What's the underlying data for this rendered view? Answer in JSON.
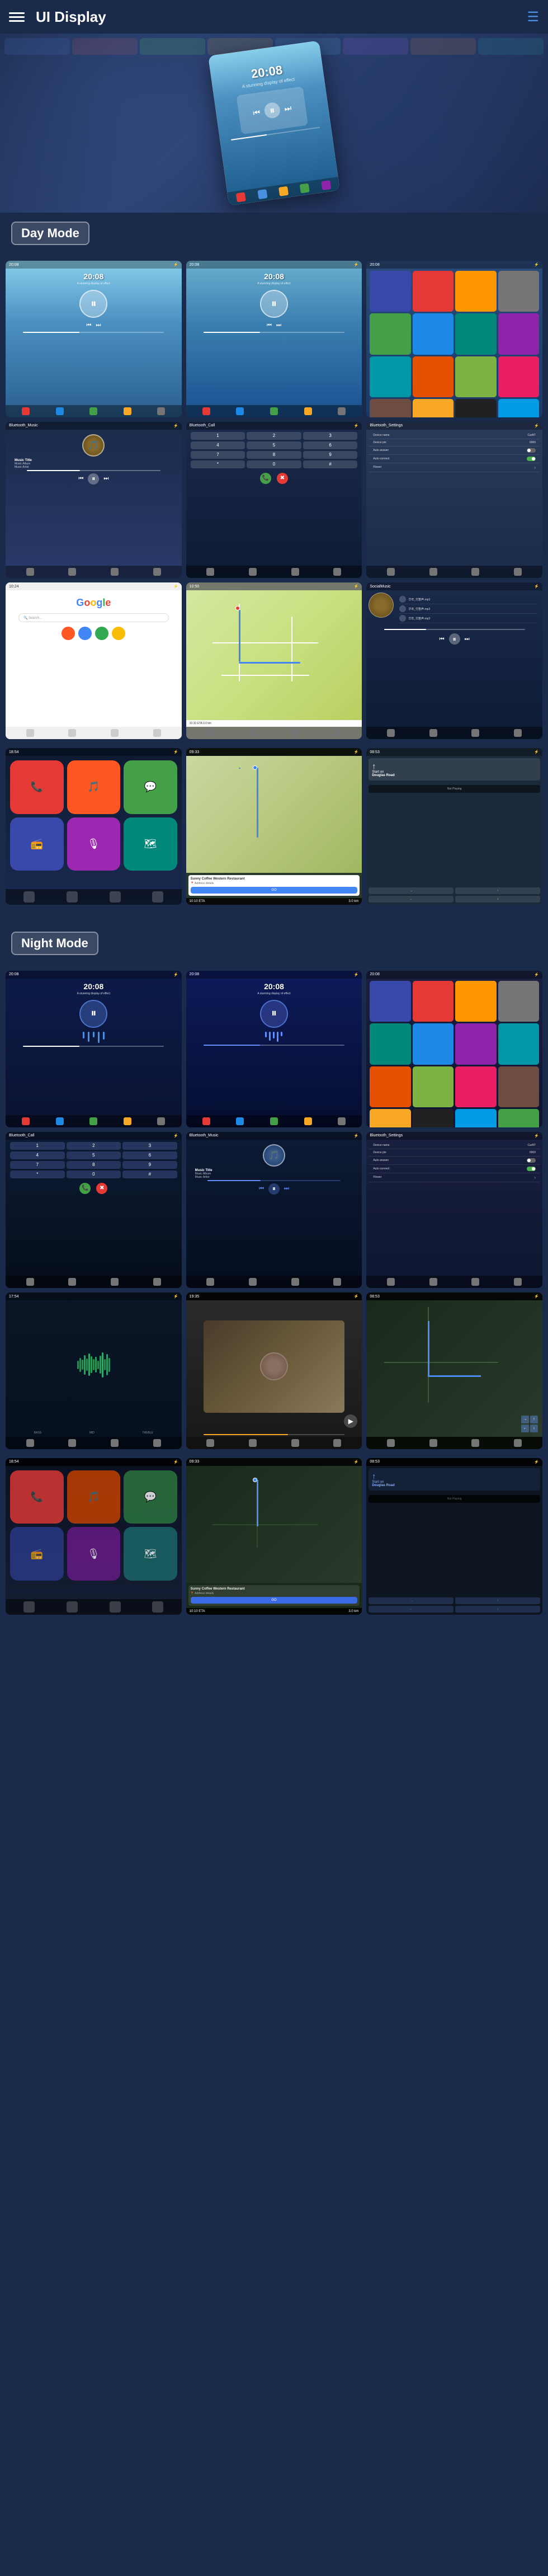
{
  "header": {
    "title": "UI Display",
    "menu_label": "Menu",
    "nav_label": "Navigation"
  },
  "day_mode": {
    "label": "Day Mode",
    "screens": [
      {
        "id": "day-music-1",
        "type": "music",
        "time": "20:08",
        "subtitle": "A stunning display of effect"
      },
      {
        "id": "day-music-2",
        "type": "music",
        "time": "20:08",
        "subtitle": "A stunning display of effect"
      },
      {
        "id": "day-apps",
        "type": "apps"
      },
      {
        "id": "day-bt-music",
        "type": "bt_music",
        "label": "Bluetooth_Music",
        "music_title": "Music Title",
        "music_album": "Music Album",
        "music_artist": "Music Artist"
      },
      {
        "id": "day-bt-call",
        "type": "bt_call",
        "label": "Bluetooth_Call"
      },
      {
        "id": "day-bt-settings",
        "type": "bt_settings",
        "label": "Bluetooth_Settings",
        "device_name_label": "Device name",
        "device_name_val": "CarBT",
        "device_pin_label": "Device pin",
        "device_pin_val": "0000",
        "auto_answer_label": "Auto answer",
        "auto_connect_label": "Auto connect",
        "flower_label": "Flower"
      },
      {
        "id": "day-google",
        "type": "google"
      },
      {
        "id": "day-map",
        "type": "map",
        "eta_time": "10/10 ETA",
        "eta_distance": "3.0 km"
      },
      {
        "id": "day-social",
        "type": "social",
        "label": "SocialMusic",
        "songs": [
          "华年_付笛声.mp3",
          "华年_付笛声.mp3",
          "华年_付笛声.mp3"
        ]
      }
    ]
  },
  "carplay_section": {
    "screens": [
      {
        "id": "carplay-apps-1",
        "type": "carplay_apps"
      },
      {
        "id": "carplay-nav-1",
        "type": "nav_route",
        "restaurant": "Sunny Coffee Western Restaurant",
        "eta_label": "10:10 ETA",
        "distance": "3.0 km",
        "go_label": "GO"
      },
      {
        "id": "carplay-nav-right",
        "type": "nav_direction",
        "time": "08:53",
        "direction_text": "Start on Douglas Road",
        "not_playing": "Not Playing"
      }
    ]
  },
  "night_mode": {
    "label": "Night Mode",
    "screens": [
      {
        "id": "night-music-1",
        "type": "night_music",
        "time": "20:08",
        "subtitle": "A stunning display of effect"
      },
      {
        "id": "night-music-2",
        "type": "night_music",
        "time": "20:08",
        "subtitle": "A stunning display of effect"
      },
      {
        "id": "night-apps",
        "type": "night_apps"
      },
      {
        "id": "night-bt-call",
        "type": "night_bt_call",
        "label": "Bluetooth_Call"
      },
      {
        "id": "night-bt-music",
        "type": "night_bt_music",
        "label": "Bluetooth_Music",
        "music_title": "Music Title",
        "music_album": "Music Album",
        "music_artist": "Music Artist"
      },
      {
        "id": "night-bt-settings",
        "type": "night_bt_settings",
        "label": "Bluetooth_Settings",
        "device_name_label": "Device name",
        "device_name_val": "CarBT",
        "device_pin_label": "Device pin",
        "device_pin_val": "0000",
        "auto_answer_label": "Auto answer",
        "auto_connect_label": "Auto connect",
        "flower_label": "Flower"
      },
      {
        "id": "night-waveform",
        "type": "waveform"
      },
      {
        "id": "night-food",
        "type": "food_video"
      },
      {
        "id": "night-nav",
        "type": "nav_night"
      }
    ]
  },
  "night_carplay": {
    "screens": [
      {
        "id": "night-carplay-apps",
        "type": "night_carplay_apps"
      },
      {
        "id": "night-nav-route",
        "type": "night_nav_route",
        "restaurant": "Sunny Coffee Western Restaurant",
        "eta_label": "10:10 ETA",
        "distance": "3.0 km",
        "go_label": "GO"
      },
      {
        "id": "night-nav-direction",
        "type": "night_nav_direction",
        "direction_text": "Start on Douglas Road",
        "not_playing": "Not Playing"
      }
    ]
  },
  "colors": {
    "day_badge_bg": "rgba(255,255,255,0.15)",
    "night_badge_bg": "rgba(255,255,255,0.15)",
    "accent_blue": "#4285f4",
    "accent_green": "#4CAF50"
  }
}
